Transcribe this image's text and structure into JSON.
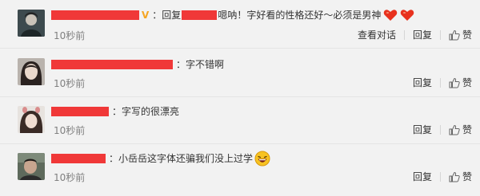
{
  "comments": [
    {
      "text": "：回复",
      "reply_tail": "嗯呐！字好看的性格还好～必须是男神",
      "badge": "V",
      "time": "10秒前",
      "actions": {
        "view_conversation": "查看对话",
        "reply": "回复",
        "like": "赞"
      },
      "emoji": [
        "heart",
        "heart"
      ]
    },
    {
      "text": "：字不错啊",
      "time": "10秒前",
      "actions": {
        "reply": "回复",
        "like": "赞"
      }
    },
    {
      "text": "：字写的很漂亮",
      "time": "10秒前",
      "actions": {
        "reply": "回复",
        "like": "赞"
      }
    },
    {
      "text": "：小岳岳这字体还骗我们没上过学",
      "time": "10秒前",
      "actions": {
        "reply": "回复",
        "like": "赞"
      },
      "emoji": [
        "laughing-face"
      ]
    }
  ],
  "colors": {
    "redaction": "#f03838",
    "background": "#f2f2f2",
    "meta": "#808080",
    "badge": "#f5a623",
    "heart": "#e8321e"
  }
}
